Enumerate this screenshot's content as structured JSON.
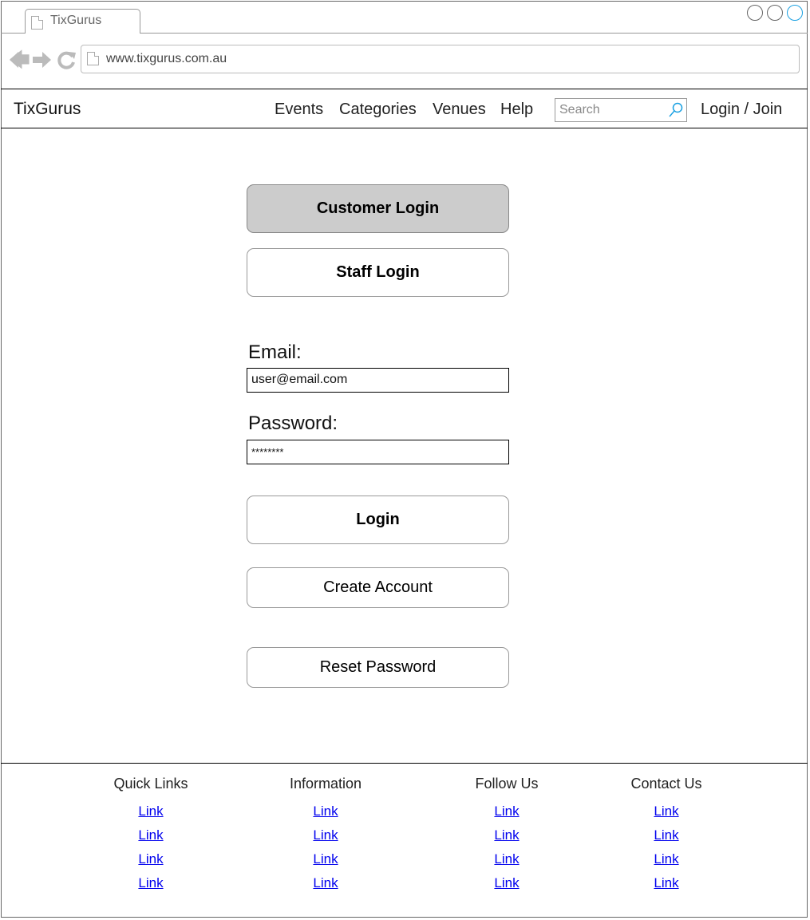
{
  "browser": {
    "tab_title": "TixGurus",
    "url": "www.tixgurus.com.au"
  },
  "header": {
    "brand": "TixGurus",
    "nav": [
      "Events",
      "Categories",
      "Venues",
      "Help"
    ],
    "search_placeholder": "Search",
    "login_join": "Login / Join"
  },
  "login": {
    "customer_login": "Customer Login",
    "staff_login": "Staff Login",
    "email_label": "Email:",
    "email_value": "user@email.com",
    "password_label": "Password:",
    "password_value": "********",
    "login_button": "Login",
    "create_account": "Create Account",
    "reset_password": "Reset Password"
  },
  "footer": {
    "columns": [
      {
        "title": "Quick Links",
        "links": [
          "Link",
          "Link",
          "Link",
          "Link"
        ]
      },
      {
        "title": "Information",
        "links": [
          "Link",
          "Link",
          "Link",
          "Link"
        ]
      },
      {
        "title": "Follow Us",
        "links": [
          "Link",
          "Link",
          "Link",
          "Link"
        ]
      },
      {
        "title": "Contact Us",
        "links": [
          "Link",
          "Link",
          "Link",
          "Link"
        ]
      }
    ]
  },
  "colors": {
    "selected_button": "#cccccc",
    "link": "#0000ee",
    "active_window_button": "#1ba1e2"
  }
}
